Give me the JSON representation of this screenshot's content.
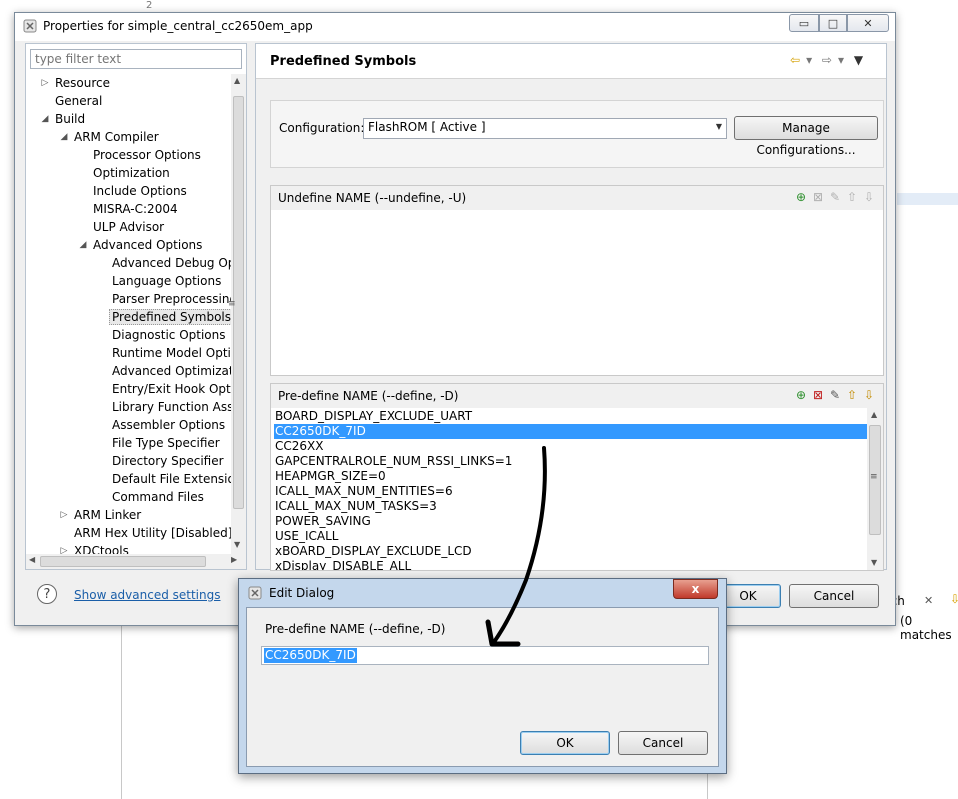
{
  "background": {
    "line_number": "2",
    "search_tab_label": "rch",
    "search_matches": "(0 matches"
  },
  "window": {
    "title": "Properties for simple_central_cc2650em_app",
    "min_glyph": "▭",
    "max_glyph": "□",
    "close_glyph": "✕"
  },
  "filter": {
    "placeholder": "type filter text"
  },
  "tree": {
    "items": [
      {
        "label": "Resource",
        "arrow": "▷"
      },
      {
        "label": "General",
        "arrow": ""
      },
      {
        "label": "Build",
        "arrow": "◢"
      },
      {
        "label": "ARM Compiler",
        "arrow": "◢"
      },
      {
        "label": "Processor Options",
        "arrow": ""
      },
      {
        "label": "Optimization",
        "arrow": ""
      },
      {
        "label": "Include Options",
        "arrow": ""
      },
      {
        "label": "MISRA-C:2004",
        "arrow": ""
      },
      {
        "label": "ULP Advisor",
        "arrow": ""
      },
      {
        "label": "Advanced Options",
        "arrow": "◢"
      },
      {
        "label": "Advanced Debug Opti",
        "arrow": ""
      },
      {
        "label": "Language Options",
        "arrow": ""
      },
      {
        "label": "Parser Preprocessing C",
        "arrow": ""
      },
      {
        "label": "Predefined Symbols",
        "arrow": ""
      },
      {
        "label": "Diagnostic Options",
        "arrow": ""
      },
      {
        "label": "Runtime Model Option",
        "arrow": ""
      },
      {
        "label": "Advanced Optimizatio",
        "arrow": ""
      },
      {
        "label": "Entry/Exit Hook Optior",
        "arrow": ""
      },
      {
        "label": "Library Function Assur",
        "arrow": ""
      },
      {
        "label": "Assembler Options",
        "arrow": ""
      },
      {
        "label": "File Type Specifier",
        "arrow": ""
      },
      {
        "label": "Directory Specifier",
        "arrow": ""
      },
      {
        "label": "Default File Extensions",
        "arrow": ""
      },
      {
        "label": "Command Files",
        "arrow": ""
      },
      {
        "label": "ARM Linker",
        "arrow": "▷"
      },
      {
        "label": "ARM Hex Utility  [Disabled]",
        "arrow": ""
      },
      {
        "label": "XDCtools",
        "arrow": "▷"
      }
    ]
  },
  "page": {
    "title": "Predefined Symbols"
  },
  "configuration": {
    "label": "Configuration:",
    "selected": "FlashROM  [ Active ]",
    "manage_button": "Manage Configurations..."
  },
  "undefine": {
    "header": "Undefine NAME (--undefine, -U)"
  },
  "predefine": {
    "header": "Pre-define NAME (--define, -D)",
    "items": [
      "BOARD_DISPLAY_EXCLUDE_UART",
      "CC2650DK_7ID",
      "CC26XX",
      "GAPCENTRALROLE_NUM_RSSI_LINKS=1",
      "HEAPMGR_SIZE=0",
      "ICALL_MAX_NUM_ENTITIES=6",
      "ICALL_MAX_NUM_TASKS=3",
      "POWER_SAVING",
      "USE_ICALL",
      "xBOARD_DISPLAY_EXCLUDE_LCD",
      "xDisplay_DISABLE_ALL"
    ],
    "selected_index": 1
  },
  "footer": {
    "help_glyph": "?",
    "advanced_link": "Show advanced settings",
    "ok_label": "OK",
    "cancel_label": "Cancel"
  },
  "edit_dialog": {
    "title": "Edit Dialog",
    "close_glyph": "x",
    "field_label": "Pre-define NAME (--define, -D)",
    "field_value": "CC2650DK_7ID",
    "ok_label": "OK",
    "cancel_label": "Cancel"
  },
  "colors": {
    "selection": "#3399ff",
    "link": "#1a5ea8",
    "close_button": "#c0392b"
  }
}
